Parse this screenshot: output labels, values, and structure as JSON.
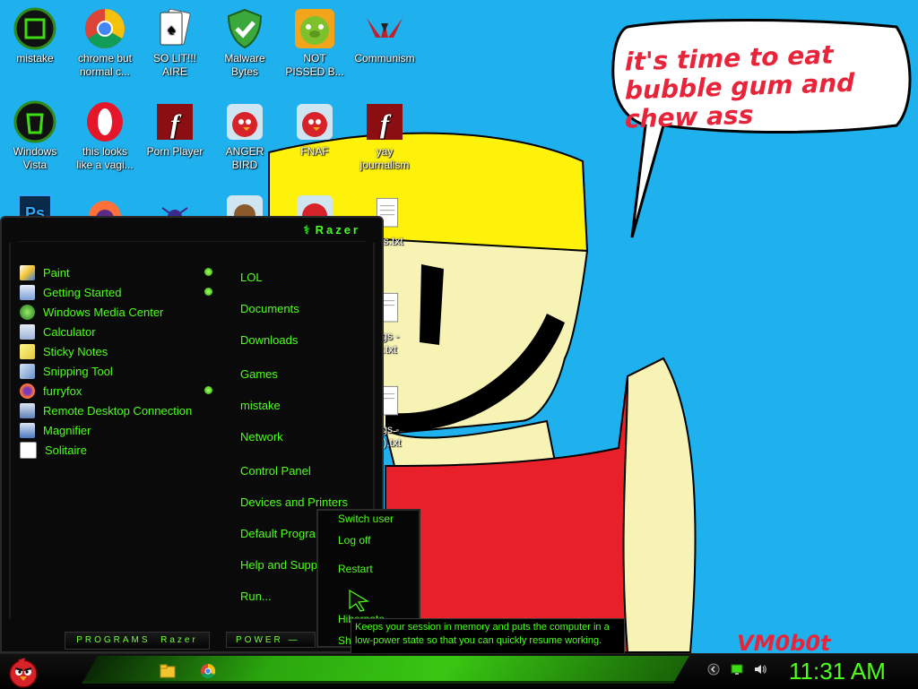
{
  "desktop": {
    "icons": [
      {
        "label": "mistake",
        "icon": "razer-logo-icon"
      },
      {
        "label": "chrome but\nnormal c...",
        "icon": "chrome-icon"
      },
      {
        "label": "SO LIT!!!\nAIRE",
        "icon": "solitaire-icon"
      },
      {
        "label": "Malware\nBytes",
        "icon": "shield-check-icon"
      },
      {
        "label": "NOT\nPISSED B...",
        "icon": "green-pig-icon"
      },
      {
        "label": "Communism",
        "icon": "communism-logo-icon"
      },
      {
        "label": "Windows\nVista",
        "icon": "recycle-bin-icon"
      },
      {
        "label": "this looks\nlike a vagi...",
        "icon": "opera-icon"
      },
      {
        "label": "Porn Player",
        "icon": "flash-icon"
      },
      {
        "label": "ANGER\nBIRD",
        "icon": "angry-bird-icon"
      },
      {
        "label": "FNAF",
        "icon": "angry-bird-icon"
      },
      {
        "label": "yay\njournalism",
        "icon": "flash-icon"
      },
      {
        "label": "ngs.txt",
        "icon": "text-file-icon"
      },
      {
        "label": "ngs -\ny.txt",
        "icon": "text-file-icon"
      },
      {
        "label": "ngs -\n(2).txt",
        "icon": "text-file-icon"
      }
    ],
    "speech_bubble": "it's time to eat bubble gum and chew ass",
    "signature": "VM0b0t"
  },
  "start_menu": {
    "brand": "Razer",
    "programs": [
      {
        "label": "Paint",
        "icon": "paint-icon",
        "has_submenu": true
      },
      {
        "label": "Getting Started",
        "icon": "getting-started-icon",
        "has_submenu": true
      },
      {
        "label": "Windows Media Center",
        "icon": "media-center-icon",
        "has_submenu": false
      },
      {
        "label": "Calculator",
        "icon": "calculator-icon",
        "has_submenu": false
      },
      {
        "label": "Sticky Notes",
        "icon": "sticky-notes-icon",
        "has_submenu": false
      },
      {
        "label": "Snipping Tool",
        "icon": "snipping-tool-icon",
        "has_submenu": false
      },
      {
        "label": "furryfox",
        "icon": "firefox-icon",
        "has_submenu": true
      },
      {
        "label": "Remote Desktop Connection",
        "icon": "remote-desktop-icon",
        "has_submenu": false
      },
      {
        "label": "Magnifier",
        "icon": "magnifier-icon",
        "has_submenu": false
      },
      {
        "label": "Solitaire",
        "icon": "solitaire-icon",
        "has_submenu": false
      }
    ],
    "places": [
      "LOL",
      "Documents",
      "Downloads",
      "Games",
      "mistake",
      "Network",
      "Control Panel",
      "Devices and Printers",
      "Default Progra",
      "Help and Supp",
      "Run..."
    ],
    "programs_label": "PROGRAMS",
    "power_label": "POWER",
    "power_menu": {
      "items": [
        "Switch user",
        "Log off",
        "Restart",
        "Hibernate",
        "Sh"
      ]
    },
    "tooltip": "Keeps your session in memory and puts the computer in a low-power state so that you can quickly resume working."
  },
  "taskbar": {
    "pinned": [
      {
        "icon": "folder-icon"
      },
      {
        "icon": "chrome-icon"
      }
    ],
    "tray": [
      {
        "icon": "show-hidden-icons-icon"
      },
      {
        "icon": "network-icon"
      },
      {
        "icon": "speaker-icon"
      }
    ],
    "clock": "11:31 AM"
  },
  "colors": {
    "accent": "#4dff1a",
    "desktop_bg": "#1fb0ee",
    "speech_text": "#e8243a"
  }
}
